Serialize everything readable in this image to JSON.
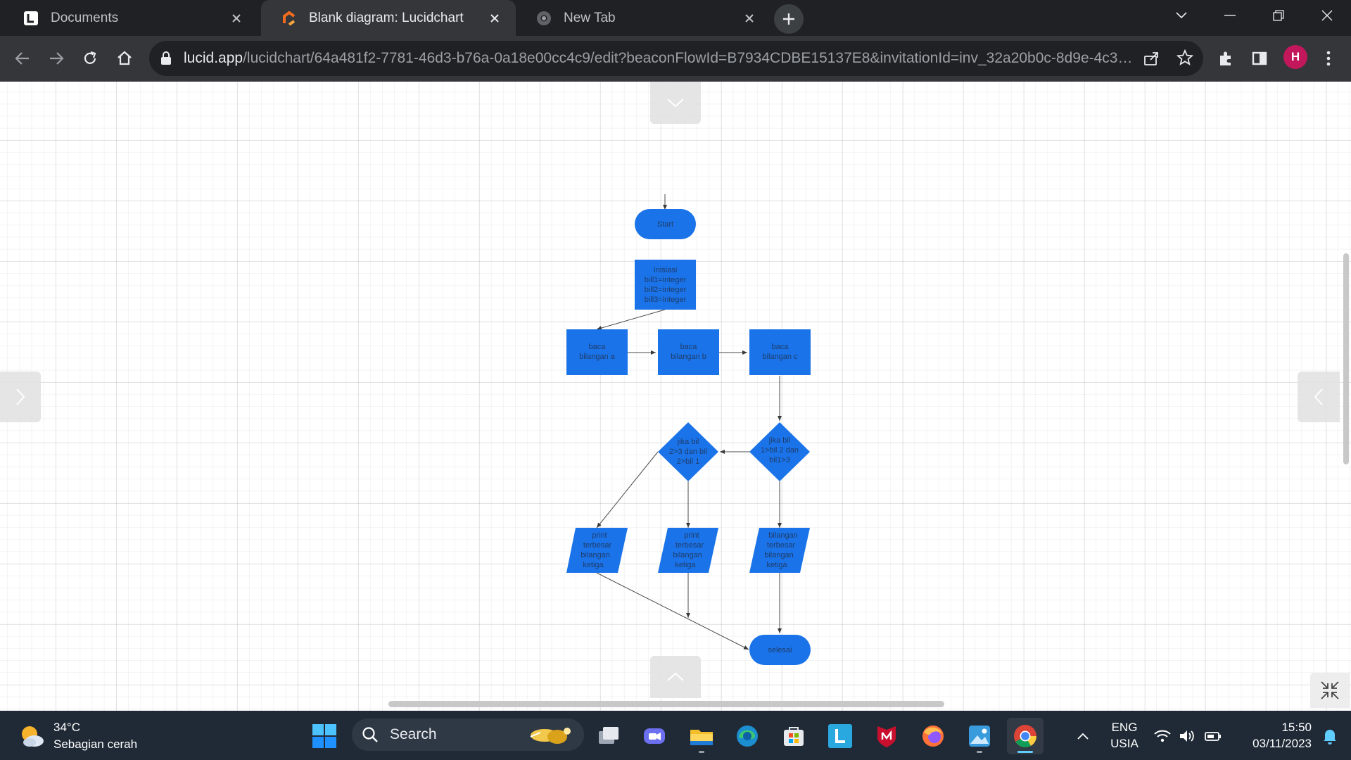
{
  "browser": {
    "tabs": [
      {
        "title": "Documents",
        "favicon": "lucid-doc-icon",
        "active": false
      },
      {
        "title": "Blank diagram: Lucidchart",
        "favicon": "lucidchart-icon",
        "active": true
      },
      {
        "title": "New Tab",
        "favicon": "chrome-icon",
        "active": false
      }
    ],
    "url_host": "lucid.app",
    "url_path": "/lucidchart/64a481f2-7781-46d3-b76a-0a18e00cc4c9/edit?beaconFlowId=B7934CDBE15137E8&invitationId=inv_32a20b0c-8d9e-4c3e...",
    "profile_initial": "H",
    "profile_color": "#c2185b"
  },
  "flowchart": {
    "fill_color": "#1a73e8",
    "nodes": {
      "start": "Start",
      "init": [
        "Inisiasi",
        "bill1=integer",
        "bill2=integer",
        "bill3=integer"
      ],
      "read_a": [
        "baca",
        "bilangan a"
      ],
      "read_b": [
        "baca",
        "bilangan b"
      ],
      "read_c": [
        "baca",
        "bilangan c"
      ],
      "decision_left": [
        "jika bil",
        "2>3 dan bil",
        "2>bil 1"
      ],
      "decision_right": [
        "jika bil",
        "1>bil 2 dan",
        "bil1>3"
      ],
      "out_left": [
        "print",
        "terbesar",
        "bilangan",
        "ketiga"
      ],
      "out_mid": [
        "print",
        "terbesar",
        "bilangan",
        "ketiga"
      ],
      "out_right": [
        "bilangan",
        "terbesar",
        "bilangan",
        "ketiga"
      ],
      "end": "selesai"
    }
  },
  "taskbar": {
    "weather_temp": "34°C",
    "weather_desc": "Sebagian cerah",
    "search_label": "Search",
    "lang_top": "ENG",
    "lang_bottom": "USIA",
    "time": "15:50",
    "date": "03/11/2023"
  }
}
